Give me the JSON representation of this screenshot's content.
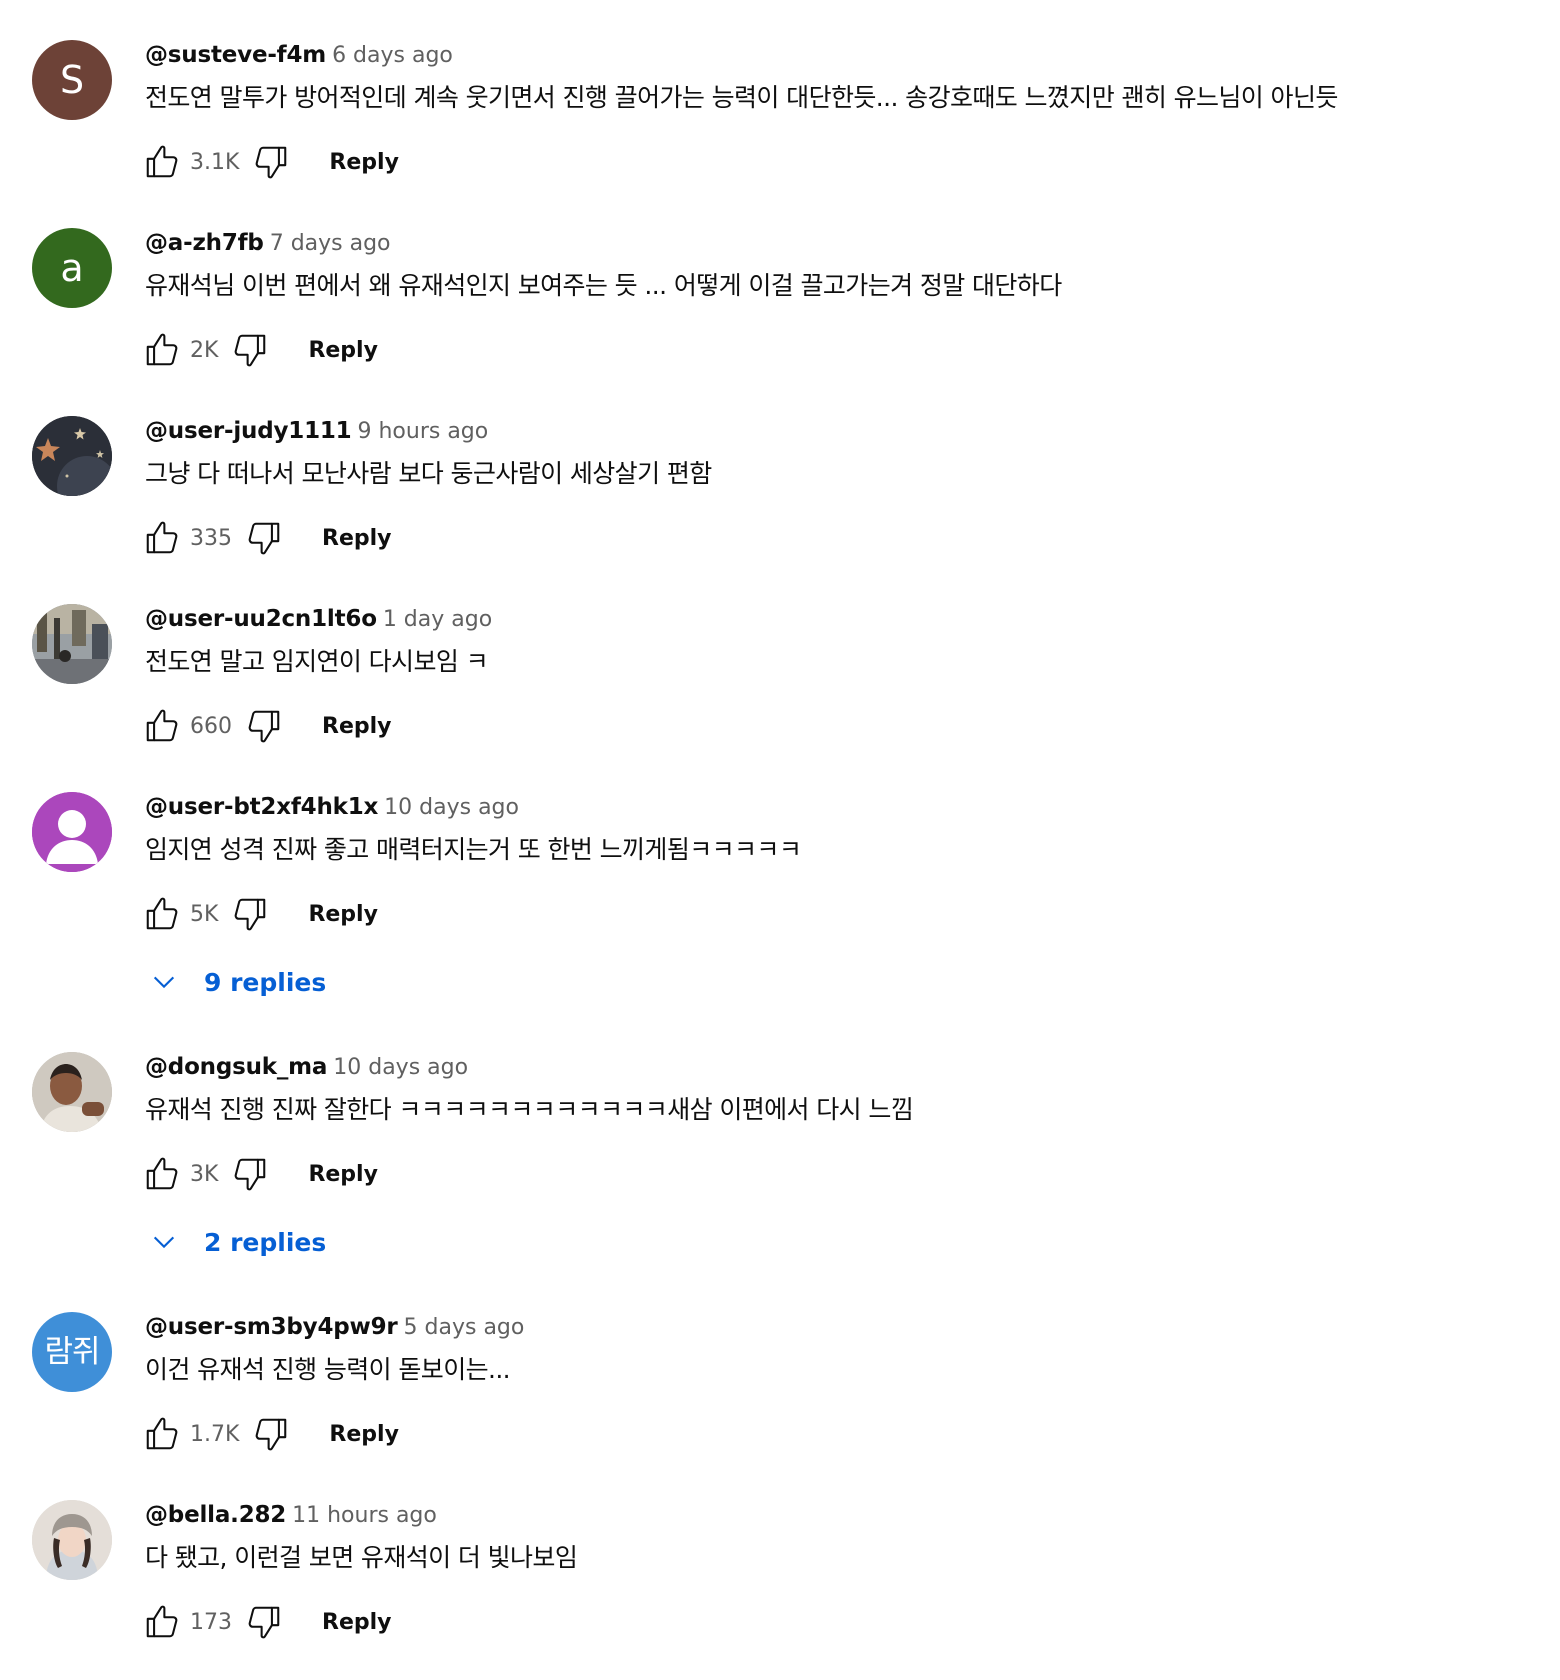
{
  "comments": [
    {
      "author": "@susteve-f4m",
      "time": "6 days ago",
      "text": "전도연 말투가 방어적인데 계속 웃기면서 진행 끌어가는 능력이 대단한듯... 송강호때도 느꼈지만 괜히 유느님이 아닌듯",
      "likes": "3.1K",
      "reply_label": "Reply",
      "avatar_letter": "S",
      "avatar_color": "#6d4237"
    },
    {
      "author": "@a-zh7fb",
      "time": "7 days ago",
      "text": "유재석님 이번 편에서 왜 유재석인지 보여주는 듯 ... 어떻게 이걸 끌고가는겨 정말 대단하다",
      "likes": "2K",
      "reply_label": "Reply",
      "avatar_letter": "a",
      "avatar_color": "#33691e"
    },
    {
      "author": "@user-judy1111",
      "time": "9 hours ago",
      "text": "그냥 다 떠나서 모난사람 보다 둥근사람이 세상살기 편함",
      "likes": "335",
      "reply_label": "Reply"
    },
    {
      "author": "@user-uu2cn1lt6o",
      "time": "1 day ago",
      "text": "전도연 말고 임지연이 다시보임 ㅋ",
      "likes": "660",
      "reply_label": "Reply"
    },
    {
      "author": "@user-bt2xf4hk1x",
      "time": "10 days ago",
      "text": "임지연 성격 진짜 좋고 매력터지는거 또 한번 느끼게됨ㅋㅋㅋㅋㅋ",
      "likes": "5K",
      "reply_label": "Reply",
      "replies_label": "9 replies",
      "avatar_color": "#ab47bc"
    },
    {
      "author": "@dongsuk_ma",
      "time": "10 days ago",
      "text": "유재석 진행 진짜 잘한다 ㅋㅋㅋㅋㅋㅋㅋㅋㅋㅋㅋㅋ새삼 이편에서 다시 느낌",
      "likes": "3K",
      "reply_label": "Reply",
      "replies_label": "2 replies"
    },
    {
      "author": "@user-sm3by4pw9r",
      "time": "5 days ago",
      "text": "이건 유재석 진행 능력이 돋보이는...",
      "likes": "1.7K",
      "reply_label": "Reply",
      "avatar_letter": "람쥐",
      "avatar_color": "#3f8fd8"
    },
    {
      "author": "@bella.282",
      "time": "11 hours ago",
      "text": "다 됐고, 이런걸 보면 유재석이 더 빛나보임",
      "likes": "173",
      "reply_label": "Reply"
    }
  ],
  "colors": {
    "link_blue": "#065fd4",
    "secondary_text": "#606060",
    "primary_text": "#0f0f0f"
  },
  "icons": {
    "like": "thumb-up-icon",
    "dislike": "thumb-down-icon",
    "expand": "chevron-down-icon"
  }
}
